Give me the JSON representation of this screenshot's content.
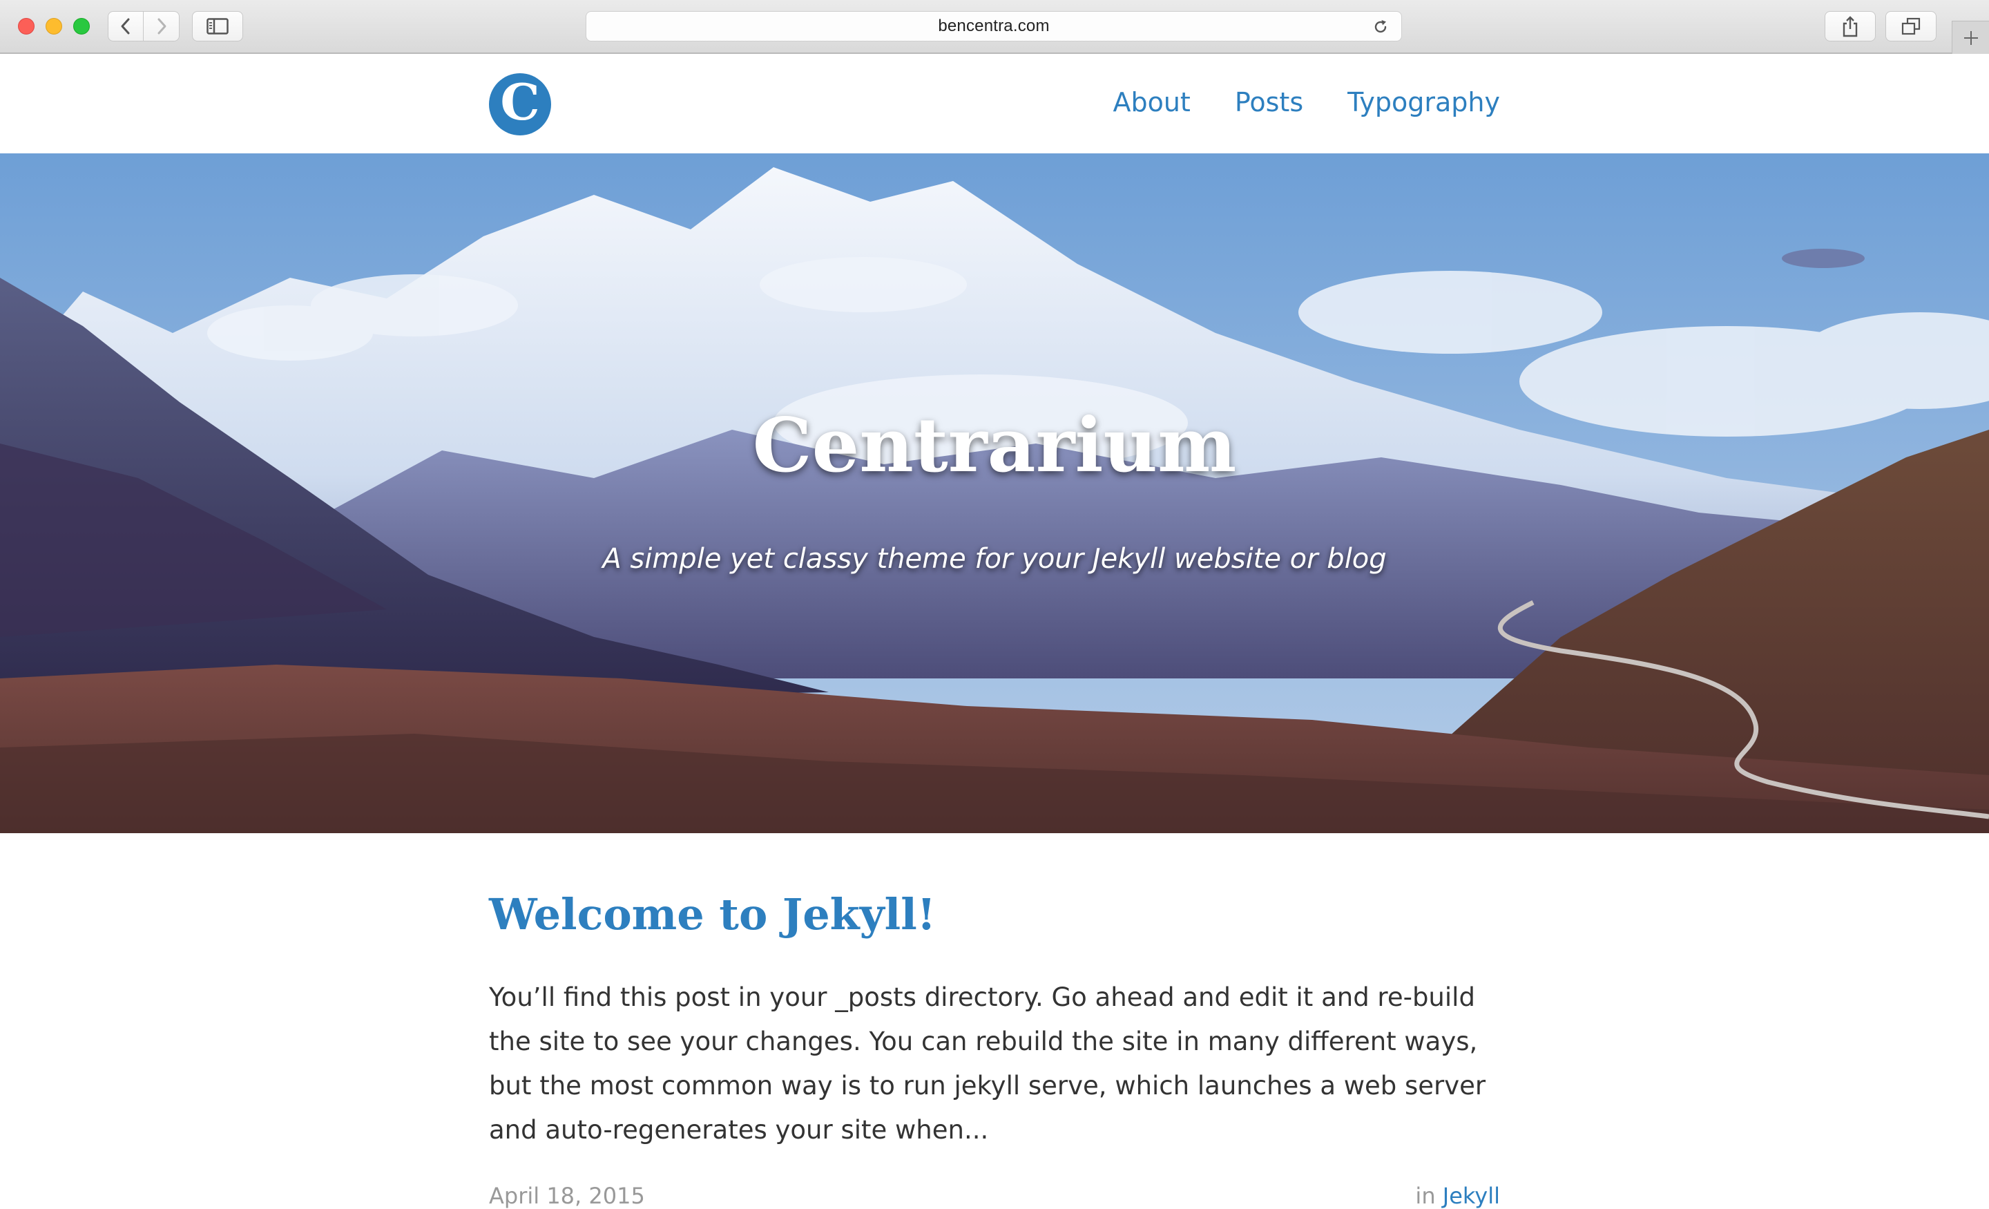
{
  "browser": {
    "url": "bencentra.com",
    "icons": {
      "back": "chevron-left-icon",
      "forward": "chevron-right-icon",
      "sidebar": "sidebar-icon",
      "reload": "reload-icon",
      "share": "share-icon",
      "tabs": "tabs-overview-icon",
      "new_tab": "plus-icon"
    }
  },
  "header": {
    "logo_letter": "C",
    "nav": [
      {
        "label": "About"
      },
      {
        "label": "Posts"
      },
      {
        "label": "Typography"
      }
    ]
  },
  "hero": {
    "title": "Centrarium",
    "subtitle": "A simple yet classy theme for your Jekyll website or blog"
  },
  "post": {
    "title": "Welcome to Jekyll!",
    "excerpt": "You’ll find this post in your _posts directory. Go ahead and edit it and re-build the site to see your changes. You can rebuild the site in many different ways, but the most common way is to run jekyll serve, which launches a web server and auto-regenerates your site when...",
    "date": "April 18, 2015",
    "category_prefix": "in",
    "category": "Jekyll"
  },
  "colors": {
    "accent": "#2d7fbf",
    "text": "#333333",
    "meta": "#999999"
  }
}
